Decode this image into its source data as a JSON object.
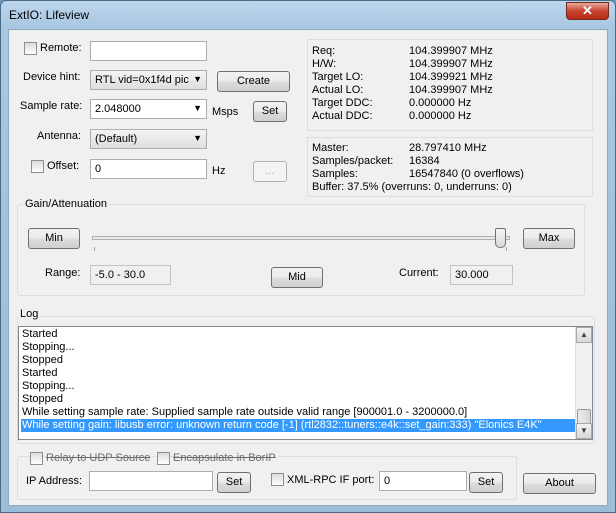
{
  "window": {
    "title": "ExtIO: Lifeview",
    "close_glyph": "✕"
  },
  "device": {
    "remote_label": "Remote:",
    "remote_value": "",
    "device_hint_label": "Device hint:",
    "device_hint_value": "RTL vid=0x1f4d pic",
    "create_label": "Create",
    "sample_rate_label": "Sample rate:",
    "sample_rate_value": "2.048000",
    "sample_rate_unit": "Msps",
    "set_label": "Set",
    "antenna_label": "Antenna:",
    "antenna_value": "(Default)",
    "offset_label": "Offset:",
    "offset_value": "0",
    "offset_unit": "Hz",
    "offset_button_label": "..."
  },
  "freq_info": [
    {
      "label": "Req:",
      "value": "104.399907 MHz"
    },
    {
      "label": "H/W:",
      "value": "104.399907 MHz"
    },
    {
      "label": "Target LO:",
      "value": "104.399921 MHz"
    },
    {
      "label": "Actual LO:",
      "value": "104.399907 MHz"
    },
    {
      "label": "Target DDC:",
      "value": "0.000000 Hz"
    },
    {
      "label": "Actual DDC:",
      "value": "0.000000 Hz"
    }
  ],
  "stats": {
    "master_label": "Master:",
    "master_value": "28.797410 MHz",
    "spp_label": "Samples/packet:",
    "spp_value": "16384",
    "samples_label": "Samples:",
    "samples_value": "16547840 (0 overflows)",
    "buffer_text": "Buffer: 37.5% (overruns: 0, underruns: 0)"
  },
  "gain": {
    "title": "Gain/Attenuation",
    "min_label": "Min",
    "max_label": "Max",
    "slider_level_fraction": 0.99,
    "range_label": "Range:",
    "range_value": "-5.0 - 30.0",
    "mid_label": "Mid",
    "current_label": "Current:",
    "current_value": "30.000"
  },
  "log": {
    "title": "Log",
    "lines": [
      "Started",
      "Stopping...",
      "Stopped",
      "Started",
      "Stopping...",
      "Stopped",
      "While setting sample rate: Supplied sample rate outside valid range [900001.0 - 3200000.0]",
      "While setting gain: libusb error: unknown return code [-1] (rtl2832::tuners::e4k::set_gain:333) \"Elonics E4K\""
    ],
    "selected_index": 7,
    "scroll_up": "▲",
    "scroll_down": "▼"
  },
  "network": {
    "relay_label": "Relay to UDP Source",
    "encapsulate_label": "Encapsulate in BorIP",
    "ip_label": "IP Address:",
    "ip_value": "",
    "ip_set_label": "Set",
    "xmlrpc_label": "XML-RPC IF port:",
    "xmlrpc_value": "0",
    "xmlrpc_set_label": "Set",
    "about_label": "About"
  },
  "icons": [
    "close-icon",
    "dropdown-arrow-icon",
    "scroll-up-icon",
    "scroll-down-icon"
  ],
  "colors": {
    "selection": "#3399ff",
    "titlebar": "#a9c7e2",
    "close": "#c7432e"
  }
}
